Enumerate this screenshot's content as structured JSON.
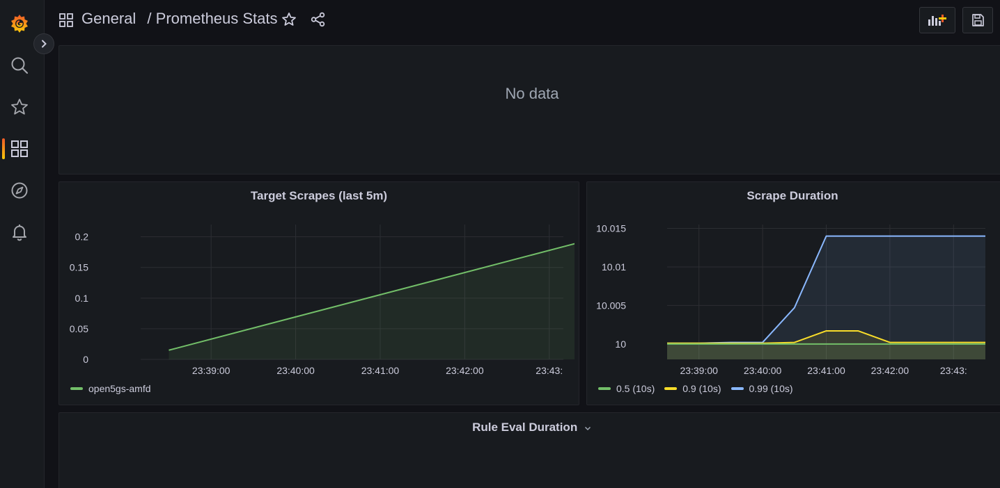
{
  "nav": {
    "items": [
      {
        "icon": "grafana-logo-icon"
      },
      {
        "icon": "search-icon"
      },
      {
        "icon": "star-icon"
      },
      {
        "icon": "dashboards-icon",
        "active": true
      },
      {
        "icon": "explore-compass-icon"
      },
      {
        "icon": "alerting-bell-icon"
      }
    ],
    "collapse_icon": "chevron-right-icon"
  },
  "header": {
    "folder": "General",
    "separator": "/",
    "title": "Prometheus Stats",
    "icons": [
      "dashboard-grid-icon",
      "star-icon",
      "share-icon",
      "add-panel-icon",
      "save-icon"
    ]
  },
  "colors": {
    "green": "#73bf69",
    "yellow": "#fade2a",
    "blue": "#8ab8ff",
    "brand": "#f05a28"
  },
  "panels": {
    "top": {
      "message": "No data"
    },
    "target_scrapes": {
      "title": "Target Scrapes (last 5m)"
    },
    "scrape_duration": {
      "title": "Scrape Duration"
    },
    "rule_eval": {
      "title": "Rule Eval Duration"
    }
  },
  "chart_data": [
    {
      "type": "area",
      "title": "Target Scrapes (last 5m)",
      "x": [
        "23:38:30",
        "23:43:30"
      ],
      "x_ticks": [
        "23:39:00",
        "23:40:00",
        "23:41:00",
        "23:42:00",
        "23:43:"
      ],
      "y_ticks": [
        "0.2",
        "0.15",
        "0.1",
        "0.05",
        "0"
      ],
      "ylim": [
        0,
        0.22
      ],
      "series": [
        {
          "name": "open5gs-amfd",
          "color": "#73bf69",
          "values": [
            0.015,
            0.196
          ]
        }
      ],
      "grid": true,
      "legend": "bottom-left"
    },
    {
      "type": "area",
      "title": "Scrape Duration",
      "x": [
        "23:38:30",
        "23:39:00",
        "23:39:30",
        "23:40:00",
        "23:40:30",
        "23:41:00",
        "23:41:30",
        "23:42:00",
        "23:42:30",
        "23:43:00",
        "23:43:30"
      ],
      "x_ticks": [
        "23:39:00",
        "23:40:00",
        "23:41:00",
        "23:42:00",
        "23:43:"
      ],
      "y_ticks": [
        "10.015",
        "10.01",
        "10.005",
        "10"
      ],
      "ylim": [
        9.998,
        10.0155
      ],
      "series": [
        {
          "name": "0.5 (10s)",
          "color": "#73bf69",
          "values": [
            10.0,
            10.0,
            10.0,
            10.0,
            10.0,
            10.0,
            10.0,
            10.0,
            10.0,
            10.0,
            10.0
          ]
        },
        {
          "name": "0.9 (10s)",
          "color": "#fade2a",
          "values": [
            10.0001,
            10.0001,
            10.0001,
            10.0001,
            10.0002,
            10.0017,
            10.0017,
            10.0002,
            10.0002,
            10.0002,
            10.0002
          ]
        },
        {
          "name": "0.99 (10s)",
          "color": "#8ab8ff",
          "values": [
            10.0001,
            10.0001,
            10.0002,
            10.0002,
            10.0047,
            10.014,
            10.014,
            10.014,
            10.014,
            10.014,
            10.014
          ]
        }
      ],
      "grid": true,
      "legend": "bottom-left"
    }
  ]
}
